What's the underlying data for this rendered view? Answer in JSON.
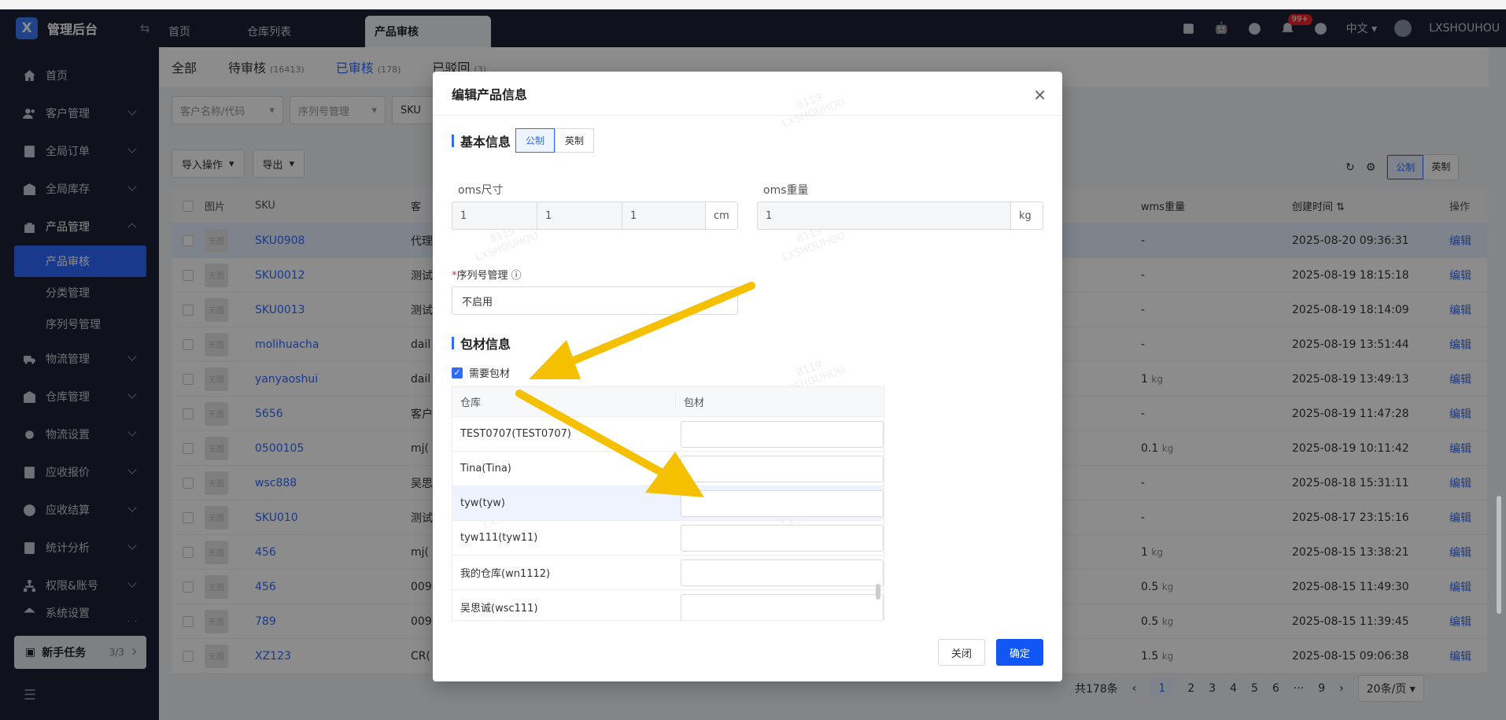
{
  "app": {
    "title": "管理后台"
  },
  "tabs": [
    {
      "label": "首页"
    },
    {
      "label": "仓库列表"
    },
    {
      "label": "产品审核"
    }
  ],
  "topbar": {
    "lang": "中文",
    "user": "LXSHOUHOU",
    "notif_count": "99+"
  },
  "sidebar": {
    "items": [
      {
        "label": "首页",
        "icon": "home-icon"
      },
      {
        "label": "客户管理",
        "icon": "users-icon"
      },
      {
        "label": "全局订单",
        "icon": "order-icon"
      },
      {
        "label": "全局库存",
        "icon": "warehouse-icon"
      },
      {
        "label": "产品管理",
        "icon": "product-icon"
      },
      {
        "label": "物流管理",
        "icon": "truck-icon"
      },
      {
        "label": "仓库管理",
        "icon": "warehouse-icon"
      },
      {
        "label": "物流设置",
        "icon": "settings-icon"
      },
      {
        "label": "应收报价",
        "icon": "quote-icon"
      },
      {
        "label": "应收结算",
        "icon": "dollar-icon"
      },
      {
        "label": "统计分析",
        "icon": "chart-icon"
      },
      {
        "label": "权限&账号",
        "icon": "org-icon"
      },
      {
        "label": "系统设置",
        "icon": "settings-icon"
      }
    ],
    "sub": [
      {
        "label": "产品审核"
      },
      {
        "label": "分类管理"
      },
      {
        "label": "序列号管理"
      }
    ],
    "newtask": {
      "label": "新手任务",
      "count": "3/3"
    }
  },
  "status_tabs": [
    {
      "label": "全部",
      "count": ""
    },
    {
      "label": "待审核",
      "count": "(16413)"
    },
    {
      "label": "已审核",
      "count": "(178)"
    },
    {
      "label": "已驳回",
      "count": "(3)"
    }
  ],
  "filters": {
    "customer": "客户名称/代码",
    "serial": "序列号管理",
    "sku": "SKU"
  },
  "actions": {
    "import": "导入操作",
    "export": "导出"
  },
  "units": {
    "metric": "公制",
    "imperial": "英制"
  },
  "table": {
    "headers": {
      "img": "图片",
      "sku": "SKU",
      "cust": "客",
      "wms": "wms重量",
      "time": "创建时间",
      "op": "操作"
    },
    "thumb": "无图",
    "op_label": "编辑",
    "rows": [
      {
        "sku": "SKU0908",
        "cust": "代理",
        "wms": "-",
        "unit": "",
        "time": "2025-08-20 09:36:31"
      },
      {
        "sku": "SKU0012",
        "cust": "测试",
        "wms": "-",
        "unit": "",
        "time": "2025-08-19 18:15:18"
      },
      {
        "sku": "SKU0013",
        "cust": "测试",
        "wms": "-",
        "unit": "",
        "time": "2025-08-19 18:14:09"
      },
      {
        "sku": "molihuacha",
        "cust": "dail",
        "wms": "-",
        "unit": "",
        "time": "2025-08-19 13:51:44"
      },
      {
        "sku": "yanyaoshui",
        "cust": "dail",
        "wms": "1",
        "unit": "kg",
        "time": "2025-08-19 13:49:13"
      },
      {
        "sku": "5656",
        "cust": "客户",
        "wms": "-",
        "unit": "",
        "time": "2025-08-19 11:47:28"
      },
      {
        "sku": "0500105",
        "cust": "mj(",
        "wms": "0.1",
        "unit": "kg",
        "time": "2025-08-19 10:11:42"
      },
      {
        "sku": "wsc888",
        "cust": "吴思",
        "wms": "-",
        "unit": "",
        "time": "2025-08-18 15:31:11"
      },
      {
        "sku": "SKU010",
        "cust": "测试",
        "wms": "-",
        "unit": "",
        "time": "2025-08-17 23:15:16"
      },
      {
        "sku": "456",
        "cust": "mj(",
        "wms": "1",
        "unit": "kg",
        "time": "2025-08-15 13:38:21"
      },
      {
        "sku": "456",
        "cust": "009",
        "wms": "0.5",
        "unit": "kg",
        "time": "2025-08-15 11:49:30"
      },
      {
        "sku": "789",
        "cust": "009",
        "wms": "0.5",
        "unit": "kg",
        "time": "2025-08-15 11:39:45"
      },
      {
        "sku": "XZ123",
        "cust": "CR(",
        "wms": "1.5",
        "unit": "kg",
        "time": "2025-08-15 09:06:38"
      }
    ]
  },
  "pager": {
    "total": "共178条",
    "pages": [
      "1",
      "2",
      "3",
      "4",
      "5",
      "6",
      "···",
      "9"
    ],
    "size": "20条/页"
  },
  "modal": {
    "title": "编辑产品信息",
    "basic": "基本信息",
    "oms_size_label": "oms尺寸",
    "oms_weight_label": "oms重量",
    "dims": [
      "1",
      "1",
      "1"
    ],
    "dim_unit": "cm",
    "weight": "1",
    "weight_unit": "kg",
    "serial_label": "序列号管理",
    "serial_value": "不启用",
    "pack": "包材信息",
    "need_pack": "需要包材",
    "pack_headers": {
      "warehouse": "仓库",
      "material": "包材"
    },
    "pack_rows": [
      {
        "wh": "TEST0707(TEST0707)"
      },
      {
        "wh": "Tina(Tina)"
      },
      {
        "wh": "tyw(tyw)"
      },
      {
        "wh": "tyw111(tyw11)"
      },
      {
        "wh": "我的仓库(wn1112)"
      },
      {
        "wh": "吴思诚(wsc111)"
      }
    ],
    "close": "关闭",
    "ok": "确定"
  },
  "watermark": {
    "line1": "8119",
    "line2": "LXSHOUHOU"
  },
  "colors": {
    "accent": "#2f6bff",
    "sidebar": "#1c2233",
    "arrow": "#f5c000"
  }
}
